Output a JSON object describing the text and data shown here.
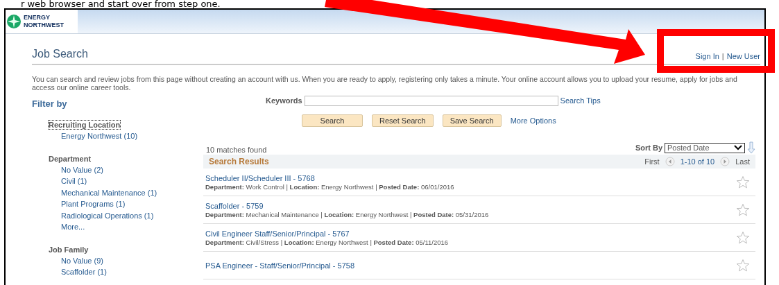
{
  "caption": "r web browser and start over from step one.",
  "header": {
    "logo_text": "ENERGY NORTHWEST"
  },
  "page": {
    "title": "Job Search",
    "links": [
      {
        "label": "Sign In"
      },
      {
        "label": "New User"
      }
    ],
    "separator": "|",
    "intro": "You can search and review jobs from this page without creating an account with us. When you are ready to apply, registering only takes a minute. Your online account allows you to upload your resume, apply for jobs and access our online career tools."
  },
  "filter": {
    "title": "Filter by",
    "groups": [
      {
        "name": "Recruiting Location",
        "items": [
          "Energy Northwest (10)"
        ]
      },
      {
        "name": "Department",
        "items": [
          "No Value (2)",
          "Civil (1)",
          "Mechanical Maintenance (1)",
          "Plant Programs (1)",
          "Radiological Operations (1)",
          "More..."
        ]
      },
      {
        "name": "Job Family",
        "items": [
          "No Value (9)",
          "Scaffolder (1)"
        ]
      }
    ]
  },
  "search": {
    "label": "Keywords",
    "tips": "Search Tips",
    "buttons": [
      "Search",
      "Reset Search",
      "Save Search"
    ],
    "more": "More Options"
  },
  "results": {
    "count": "10 matches found",
    "sort_label": "Sort By",
    "sort_value": "Posted Date",
    "title": "Search Results",
    "first": "First",
    "range": "1-10 of 10",
    "last": "Last",
    "rows": [
      {
        "title": "Scheduler II/Scheduler III - 5768",
        "details": "**Department:** Work Control | **Location:** Energy Northwest | **Posted Date:** 06/01/2016"
      },
      {
        "title": "Scaffolder - 5759",
        "details": "**Department:** Mechanical Maintenance | **Location:** Energy Northwest | **Posted Date:** 05/31/2016"
      },
      {
        "title": "Civil Engineer Staff/Senior/Principal - 5767",
        "details": "**Department:** Civil/Stress | **Location:** Energy Northwest | **Posted Date:** 05/11/2016"
      },
      {
        "title": "PSA Engineer - Staff/Senior/Principal - 5758"
      }
    ]
  }
}
